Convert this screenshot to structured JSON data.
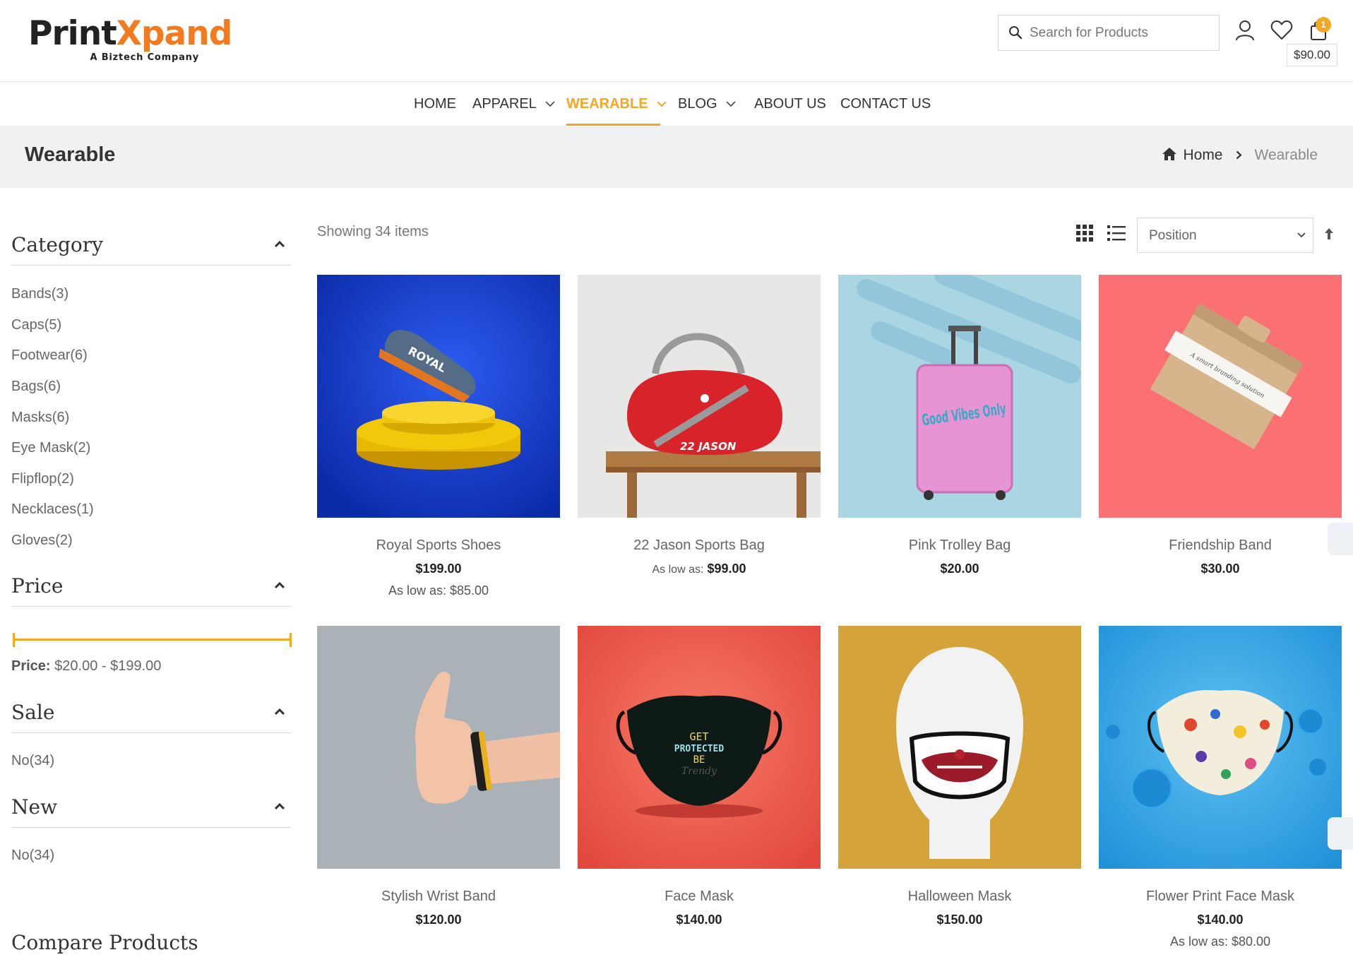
{
  "brand": {
    "name_a": "Print",
    "name_b": "Xpand",
    "tagline": "A Biztech Company"
  },
  "search": {
    "placeholder": "Search for Products"
  },
  "cart": {
    "count": "1",
    "total": "$90.00"
  },
  "nav": [
    {
      "label": "HOME"
    },
    {
      "label": "APPAREL"
    },
    {
      "label": "WEARABLE"
    },
    {
      "label": "BLOG"
    },
    {
      "label": "ABOUT US"
    },
    {
      "label": "CONTACT US"
    }
  ],
  "page": {
    "title": "Wearable",
    "breadcrumb_home": "Home",
    "breadcrumb_current": "Wearable"
  },
  "sidebar": {
    "category_title": "Category",
    "categories": [
      "Bands(3)",
      "Caps(5)",
      "Footwear(6)",
      "Bags(6)",
      "Masks(6)",
      "Eye Mask(2)",
      "Flipflop(2)",
      "Necklaces(1)",
      "Gloves(2)"
    ],
    "price_title": "Price",
    "price_label": "Price:",
    "price_range": "$20.00 - $199.00",
    "sale_title": "Sale",
    "sale_items": [
      "No(34)"
    ],
    "new_title": "New",
    "new_items": [
      "No(34)"
    ],
    "compare_title": "Compare Products"
  },
  "toolbar": {
    "showing": "Showing 34 items",
    "sort_selected": "Position"
  },
  "products": [
    {
      "name": "Royal Sports Shoes",
      "price": "$199.00",
      "low_label": "As low as:",
      "low_price": "$85.00"
    },
    {
      "name": "22 Jason Sports Bag",
      "price": "",
      "low_label": "As low as:",
      "low_price": "$99.00"
    },
    {
      "name": "Pink Trolley Bag",
      "price": "$20.00",
      "low_label": "",
      "low_price": ""
    },
    {
      "name": "Friendship Band",
      "price": "$30.00",
      "low_label": "",
      "low_price": ""
    },
    {
      "name": "Stylish Wrist Band",
      "price": "$120.00",
      "low_label": "",
      "low_price": ""
    },
    {
      "name": "Face Mask",
      "price": "$140.00",
      "low_label": "",
      "low_price": ""
    },
    {
      "name": "Halloween Mask",
      "price": "$150.00",
      "low_label": "",
      "low_price": ""
    },
    {
      "name": "Flower Print Face Mask",
      "price": "$140.00",
      "low_label": "As low as:",
      "low_price": "$80.00"
    }
  ],
  "product_art": {
    "shoe_text": "ROYAL",
    "bag_text": "22 JASON",
    "trolley_text": "Good Vibes Only",
    "band_text": "A smart branding solution",
    "mask_text_1": "GET",
    "mask_text_2": "PROTECTED",
    "mask_text_3": "BE",
    "mask_text_4": "Trendy"
  },
  "colors": {
    "accent": "#f5a623",
    "brand_orange": "#f47a20",
    "title_bar": "#f0f1f3"
  }
}
